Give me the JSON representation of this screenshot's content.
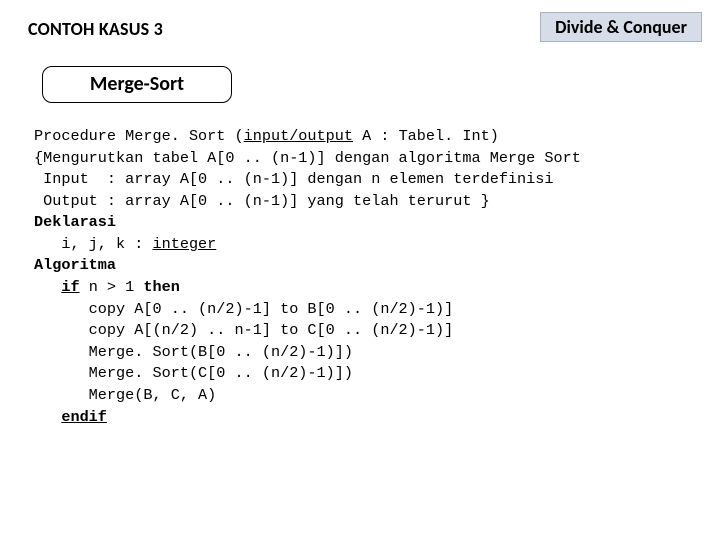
{
  "header": {
    "left_title": "CONTOH KASUS 3",
    "right_badge": "Divide & Conquer"
  },
  "subtitle": "Merge-Sort",
  "code": {
    "l1a": "Procedure Merge. Sort (",
    "l1b": "input/output",
    "l1c": " A : Tabel. Int)",
    "l2": "{Mengurutkan tabel A[0 .. (n-1)] dengan algoritma Merge Sort",
    "l3": " Input  : array A[0 .. (n-1)] dengan n elemen terdefinisi",
    "l4": " Output : array A[0 .. (n-1)] yang telah terurut }",
    "l5": "Deklarasi",
    "l6a": "   i, j, k : ",
    "l6b": "integer",
    "l7": "Algoritma",
    "l8a": "   ",
    "l8b": "if",
    "l8c": " n > 1 ",
    "l8d": "then",
    "l9": "      copy A[0 .. (n/2)-1] to B[0 .. (n/2)-1)]",
    "l10": "      copy A[(n/2) .. n-1] to C[0 .. (n/2)-1)]",
    "l11": "      Merge. Sort(B[0 .. (n/2)-1)])",
    "l12": "      Merge. Sort(C[0 .. (n/2)-1)])",
    "l13": "      Merge(B, C, A)",
    "l14a": "   ",
    "l14b": "endif"
  }
}
